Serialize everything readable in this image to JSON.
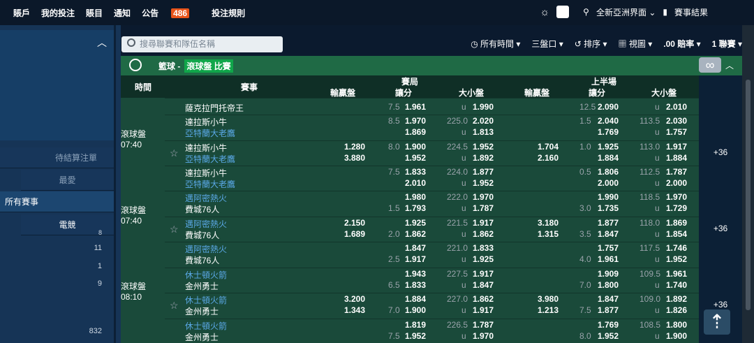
{
  "nav": {
    "items": [
      "賬戶",
      "我的投注",
      "賬目",
      "通知",
      "公告"
    ],
    "notice_count": "486",
    "rules": "投注規則"
  },
  "topright": {
    "region": "全新亞洲界面",
    "results": "賽事結果"
  },
  "left": {
    "pending": "待結算注單",
    "fav": "最愛",
    "all": "所有賽事",
    "esports": "電競",
    "counts": [
      "11",
      "1",
      "9",
      "832"
    ],
    "partial": "8"
  },
  "search": {
    "placeholder": "搜尋聯賽和隊伍名稱"
  },
  "toolbar": {
    "time": "所有時間",
    "lines": "三盤口",
    "sort": "排序",
    "view": "視圖",
    "odds": ".00 賠率",
    "league": "1 聯賽"
  },
  "sport": {
    "name": "籃球 -",
    "live": "滾球盤 比賽"
  },
  "thead": {
    "time": "時間",
    "event": "賽事",
    "full": "賽局",
    "half": "上半場",
    "ml": "輸贏盤",
    "hdp": "讓分",
    "ou": "大小盤"
  },
  "rows": [
    {
      "t1": "薩克拉門托帝王",
      "t2": "",
      "ml1": "",
      "ml2": "",
      "h1": "",
      "h2": "",
      "hp1": "7.5",
      "ho1": "1.961",
      "hp2": "",
      "ho2": "",
      "ou_l": "",
      "oo1": "",
      "uline": "u",
      "oo2": "1.990",
      "hml1": "",
      "hml2": "",
      "hh1": "",
      "hh2": "",
      "hhp1": "12.5",
      "hho1": "2.090",
      "hhp2": "",
      "hho2": "",
      "hou_l": "",
      "hoo1": "",
      "hoo2": "2.010"
    },
    {
      "t1": "達拉斯小牛",
      "t2": "亞特蘭大老鷹",
      "ml1": "",
      "ml2": "",
      "hp1": "8.5",
      "ho1": "1.970",
      "hp2": "",
      "ho2": "1.869",
      "ou_l": "225.0",
      "oo1": "2.020",
      "uline": "u",
      "oo2": "1.813",
      "hml1": "",
      "hml2": "",
      "hhp1": "1.5",
      "hho1": "2.040",
      "hhp2": "",
      "hho2": "1.769",
      "hou_l": "113.5",
      "hoo1": "2.030",
      "hoo2": "1.757"
    },
    {
      "t1": "達拉斯小牛",
      "t2": "亞特蘭大老鷹",
      "ml1": "1.280",
      "ml2": "3.880",
      "hp1": "8.0",
      "ho1": "1.900",
      "hp2": "",
      "ho2": "1.952",
      "ou_l": "224.5",
      "oo1": "1.952",
      "uline": "u",
      "oo2": "1.892",
      "hml1": "1.704",
      "hml2": "2.160",
      "hhp1": "1.0",
      "hho1": "1.925",
      "hhp2": "",
      "hho2": "1.884",
      "hou_l": "113.0",
      "hoo1": "1.917",
      "hoo2": "1.884"
    },
    {
      "t1": "達拉斯小牛",
      "t2": "亞特蘭大老鷹",
      "ml1": "",
      "ml2": "",
      "hp1": "7.5",
      "ho1": "1.833",
      "hp2": "",
      "ho2": "2.010",
      "ou_l": "224.0",
      "oo1": "1.877",
      "uline": "u",
      "oo2": "1.952",
      "hml1": "",
      "hml2": "",
      "hhp1": "0.5",
      "hho1": "1.806",
      "hhp2": "",
      "hho2": "2.000",
      "hou_l": "112.5",
      "hoo1": "1.787",
      "hoo2": "2.000"
    },
    {
      "t1": "邁阿密熱火",
      "t2": "費城76人",
      "ml1": "",
      "ml2": "",
      "hp1": "",
      "ho1": "1.980",
      "hp2": "1.5",
      "ho2": "1.793",
      "ou_l": "222.0",
      "oo1": "1.970",
      "uline": "u",
      "oo2": "1.787",
      "hml1": "",
      "hml2": "",
      "hhp1": "",
      "hho1": "1.990",
      "hhp2": "3.0",
      "hho2": "1.735",
      "hou_l": "118.5",
      "hoo1": "1.970",
      "hoo2": "1.729"
    },
    {
      "t1": "邁阿密熱火",
      "t2": "費城76人",
      "ml1": "2.150",
      "ml2": "1.689",
      "hp1": "",
      "ho1": "1.925",
      "hp2": "2.0",
      "ho2": "1.862",
      "ou_l": "221.5",
      "oo1": "1.917",
      "uline": "u",
      "oo2": "1.862",
      "hml1": "3.180",
      "hml2": "1.315",
      "hhp1": "",
      "hho1": "1.877",
      "hhp2": "3.5",
      "hho2": "1.847",
      "hou_l": "118.0",
      "hoo1": "1.869",
      "hoo2": "1.854"
    },
    {
      "t1": "邁阿密熱火",
      "t2": "費城76人",
      "ml1": "",
      "ml2": "",
      "hp1": "",
      "ho1": "1.847",
      "hp2": "2.5",
      "ho2": "1.917",
      "ou_l": "221.0",
      "oo1": "1.833",
      "uline": "u",
      "oo2": "1.925",
      "hml1": "",
      "hml2": "",
      "hhp1": "",
      "hho1": "1.757",
      "hhp2": "4.0",
      "hho2": "1.961",
      "hou_l": "117.5",
      "hoo1": "1.746",
      "hoo2": "1.952"
    },
    {
      "t1": "休士頓火箭",
      "t2": "金州勇士",
      "ml1": "",
      "ml2": "",
      "hp1": "",
      "ho1": "1.943",
      "hp2": "6.5",
      "ho2": "1.833",
      "ou_l": "227.5",
      "oo1": "1.917",
      "uline": "u",
      "oo2": "1.847",
      "hml1": "",
      "hml2": "",
      "hhp1": "",
      "hho1": "1.909",
      "hhp2": "7.0",
      "hho2": "1.800",
      "hou_l": "109.5",
      "hoo1": "1.961",
      "hoo2": "1.740"
    },
    {
      "t1": "休士頓火箭",
      "t2": "金州勇士",
      "ml1": "3.200",
      "ml2": "1.343",
      "hp1": "",
      "ho1": "1.884",
      "hp2": "7.0",
      "ho2": "1.900",
      "ou_l": "227.0",
      "oo1": "1.862",
      "uline": "u",
      "oo2": "1.917",
      "hml1": "3.980",
      "hml2": "1.213",
      "hhp1": "",
      "hho1": "1.847",
      "hhp2": "7.5",
      "hho2": "1.877",
      "hou_l": "109.0",
      "hoo1": "1.892",
      "hoo2": "1.826"
    },
    {
      "t1": "休士頓火箭",
      "t2": "金州勇士",
      "ml1": "",
      "ml2": "",
      "hp1": "",
      "ho1": "1.819",
      "hp2": "7.5",
      "ho2": "1.952",
      "ou_l": "226.5",
      "oo1": "1.787",
      "uline": "u",
      "oo2": "1.970",
      "hml1": "",
      "hml2": "",
      "hhp1": "",
      "hho1": "1.769",
      "hhp2": "8.0",
      "hho2": "1.952",
      "hou_l": "108.5",
      "hoo1": "1.800",
      "hoo2": "1.900"
    }
  ],
  "blocks": [
    {
      "status": "滾球盤",
      "time": "07:40",
      "more": "+36"
    },
    {
      "status": "滾球盤",
      "time": "07:40",
      "more": "+36"
    },
    {
      "status": "滾球盤",
      "time": "08:10",
      "more": "+36"
    }
  ],
  "icons": {
    "sun": "sun-icon",
    "pin": "location-pin-icon",
    "chart": "bar-chart-icon",
    "clock": "clock-icon",
    "history": "history-icon",
    "view": "view-grid-icon",
    "infinity": "∞"
  }
}
